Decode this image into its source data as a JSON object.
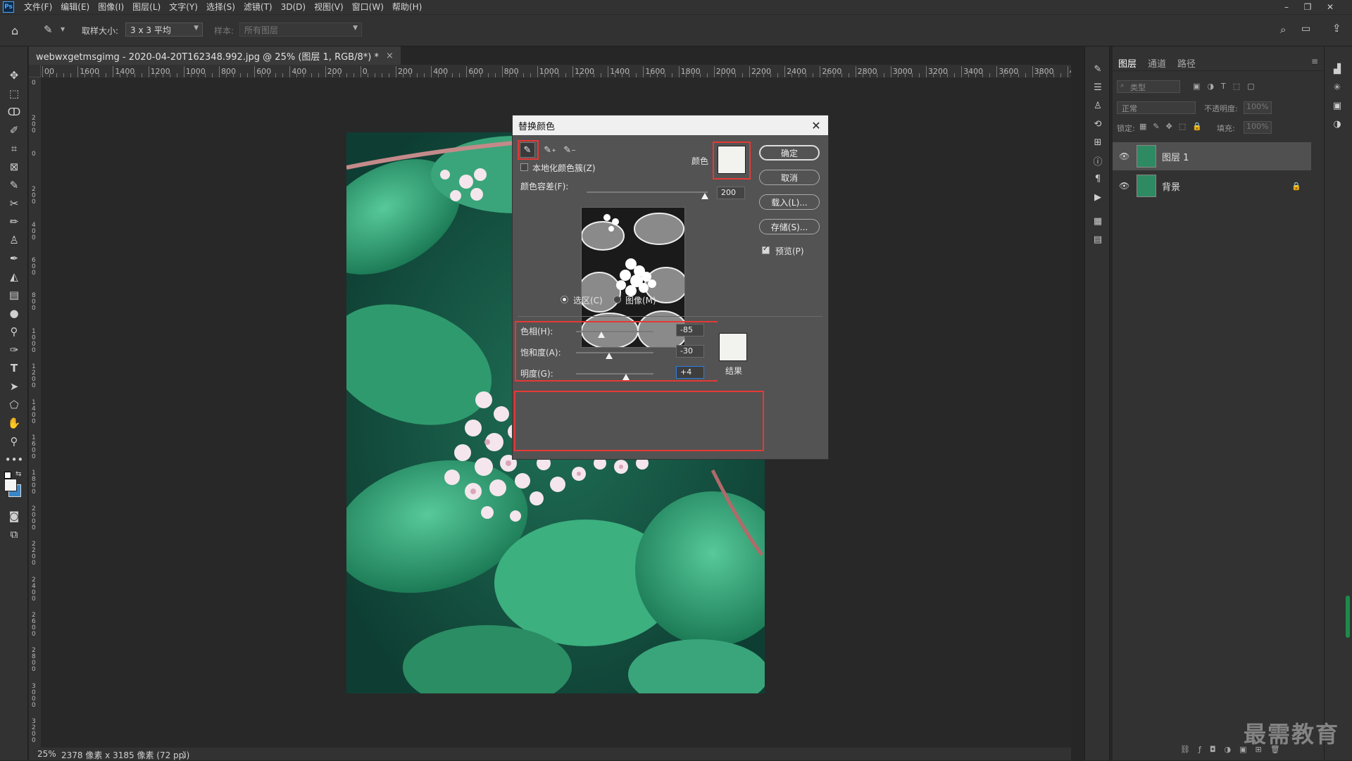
{
  "app": {
    "logo": "Ps"
  },
  "menu": [
    "文件(F)",
    "编辑(E)",
    "图像(I)",
    "图层(L)",
    "文字(Y)",
    "选择(S)",
    "滤镜(T)",
    "3D(D)",
    "视图(V)",
    "窗口(W)",
    "帮助(H)"
  ],
  "window_controls": {
    "minimize": "–",
    "restore": "❐",
    "close": "✕"
  },
  "options": {
    "sample_size_label": "取样大小:",
    "sample_size_value": "3 x 3 平均",
    "sample_label": "样本:",
    "sample_value": "所有图层"
  },
  "document": {
    "tab_title": "webwxgetmsgimg - 2020-04-20T162348.992.jpg @ 25% (图层 1, RGB/8*) *",
    "tab_close": "×"
  },
  "ruler": {
    "h_ticks": [
      "00",
      "1600",
      "1400",
      "1200",
      "1000",
      "800",
      "600",
      "400",
      "200",
      "0",
      "200",
      "400",
      "600",
      "800",
      "1000",
      "1200",
      "1400",
      "1600",
      "1800",
      "2000",
      "2200",
      "2400",
      "2600",
      "2800",
      "3000",
      "3200",
      "3400",
      "3600",
      "3800",
      "4000"
    ],
    "v_ticks": [
      "0",
      "200",
      "0",
      "200",
      "400",
      "600",
      "800",
      "1000",
      "1200",
      "1400",
      "1600",
      "1800",
      "2000",
      "2200",
      "2400",
      "2600",
      "2800",
      "3000",
      "3200"
    ]
  },
  "status": {
    "zoom": "25%",
    "size": "2378 像素 x 3185 像素 (72 ppi)",
    "arrow": "〉"
  },
  "layers_panel": {
    "tabs": [
      "图层",
      "通道",
      "路径"
    ],
    "filter_placeholder": "类型",
    "blend_mode": "正常",
    "opacity_label": "不透明度:",
    "opacity_value": "100%",
    "lock_label": "锁定:",
    "fill_label": "填充:",
    "fill_value": "100%",
    "layers": [
      {
        "name": "图层 1",
        "selected": true
      },
      {
        "name": "背景",
        "locked": true
      }
    ]
  },
  "dialog": {
    "title": "替换颜色",
    "localized_clusters": "本地化颜色簇(Z)",
    "color_label": "颜色",
    "fuzziness_label": "颜色容差(F):",
    "fuzziness_value": "200",
    "buttons": {
      "ok": "确定",
      "cancel": "取消",
      "load": "载入(L)...",
      "save": "存储(S)..."
    },
    "preview_label": "预览(P)",
    "selection_radio": "选区(C)",
    "image_radio": "图像(M)",
    "hue_label": "色相(H):",
    "hue_value": "-85",
    "saturation_label": "饱和度(A):",
    "saturation_value": "-30",
    "lightness_label": "明度(G):",
    "lightness_value": "+4",
    "result_label": "结果",
    "swatch_color": "#f2f2ee"
  },
  "watermark": "最需教育"
}
